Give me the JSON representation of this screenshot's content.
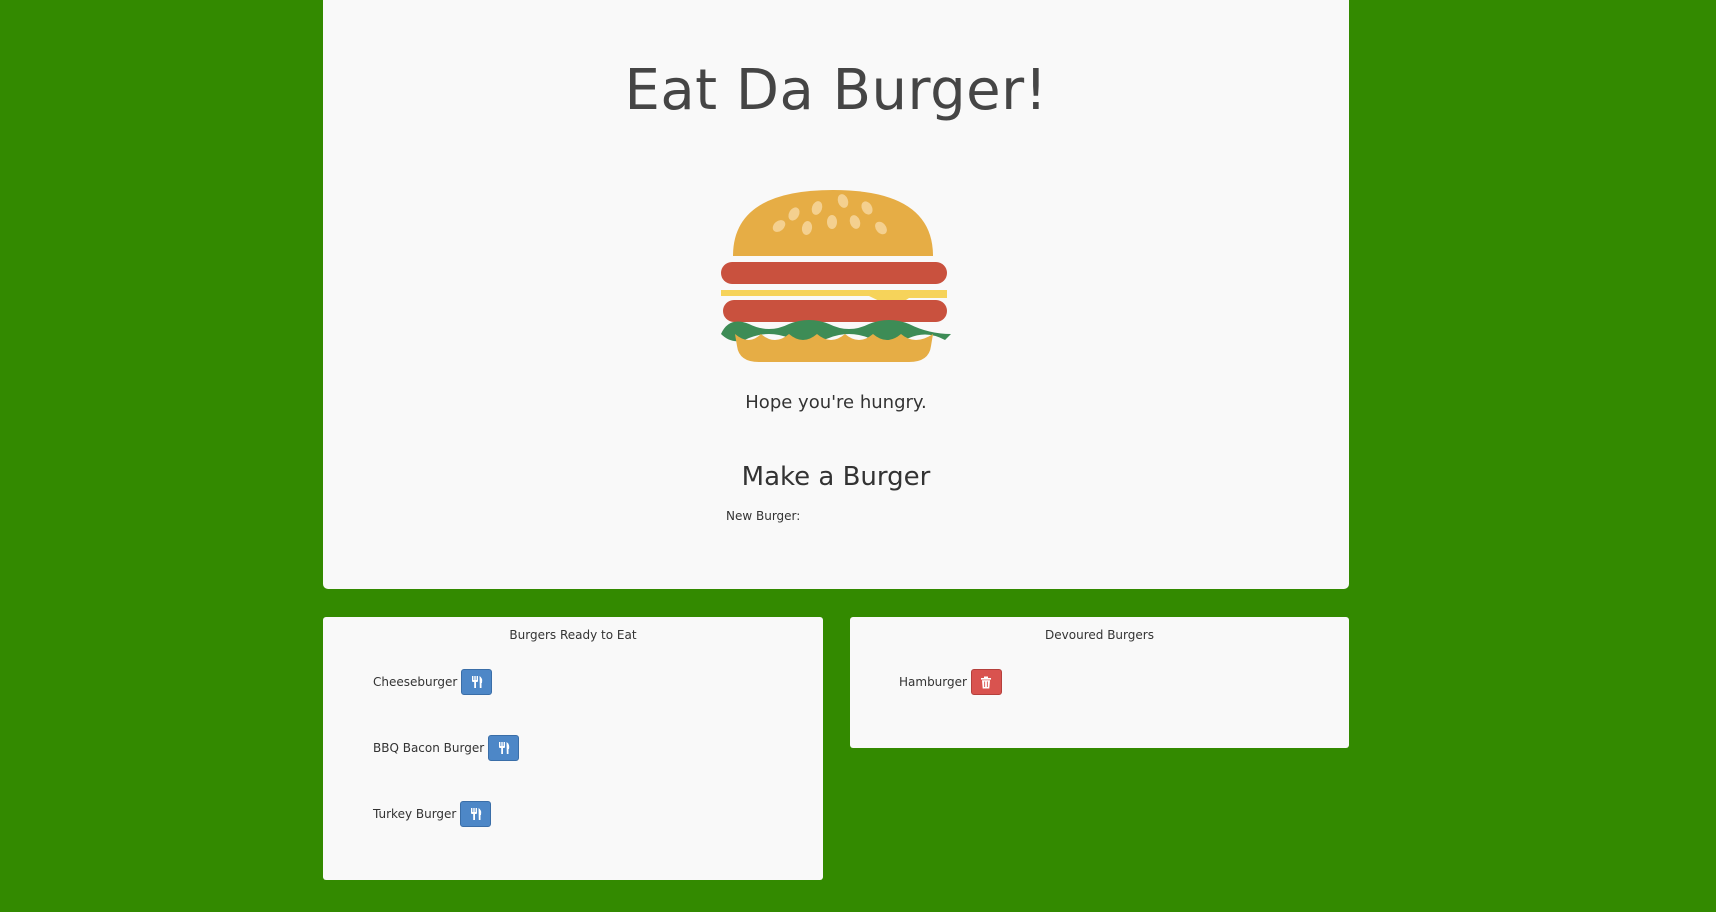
{
  "header": {
    "title": "Eat Da Burger!",
    "tagline": "Hope you're hungry."
  },
  "form": {
    "title": "Make a Burger",
    "label": "New Burger:",
    "input_value": ""
  },
  "ready_panel": {
    "title": "Burgers Ready to Eat",
    "items": [
      {
        "name": "Cheeseburger",
        "action_icon": "fork-knife-icon"
      },
      {
        "name": "BBQ Bacon Burger",
        "action_icon": "fork-knife-icon"
      },
      {
        "name": "Turkey Burger",
        "action_icon": "fork-knife-icon"
      }
    ]
  },
  "devoured_panel": {
    "title": "Devoured Burgers",
    "items": [
      {
        "name": "Hamburger",
        "action_icon": "trash-icon"
      }
    ]
  },
  "colors": {
    "background": "#338a00",
    "card": "#f9f9f9",
    "eat_button": "#4d87c7",
    "delete_button": "#d9534f"
  }
}
